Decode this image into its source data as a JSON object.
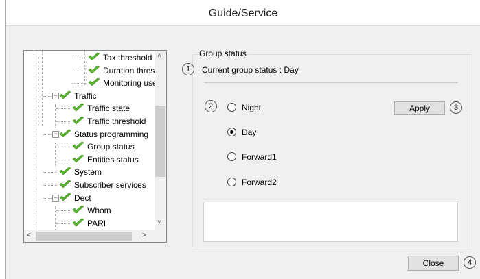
{
  "window": {
    "title": "Guide/Service"
  },
  "tree": {
    "items": [
      {
        "label": "Tax threshold",
        "level": 3
      },
      {
        "label": "Duration thres",
        "level": 3
      },
      {
        "label": "Monitoring use",
        "level": 3
      },
      {
        "label": "Traffic",
        "level": 1,
        "expander": "−"
      },
      {
        "label": "Traffic state",
        "level": 2
      },
      {
        "label": "Traffic threshold",
        "level": 2
      },
      {
        "label": "Status programming",
        "level": 1,
        "expander": "−"
      },
      {
        "label": "Group status",
        "level": 2
      },
      {
        "label": "Entities status",
        "level": 2
      },
      {
        "label": "System",
        "level": 1
      },
      {
        "label": "Subscriber services",
        "level": 1
      },
      {
        "label": "Dect",
        "level": 1,
        "expander": "−"
      },
      {
        "label": "Whom",
        "level": 2
      },
      {
        "label": "PARI",
        "level": 2
      }
    ],
    "scroll_up": "˄",
    "scroll_down": "˅",
    "scroll_left": "<",
    "scroll_right": ">"
  },
  "group_status": {
    "legend": "Group status",
    "current_status_text": "Current group status : Day",
    "options": [
      {
        "label": "Night",
        "checked": false
      },
      {
        "label": "Day",
        "checked": true
      },
      {
        "label": "Forward1",
        "checked": false
      },
      {
        "label": "Forward2",
        "checked": false
      }
    ],
    "apply_label": "Apply"
  },
  "footer": {
    "close_label": "Close"
  },
  "callouts": {
    "c1": "1",
    "c2": "2",
    "c3": "3",
    "c4": "4"
  },
  "colors": {
    "check_green": "#5cb531",
    "window_bg": "#f0f0f0",
    "button_bg": "#e1e1e1"
  }
}
